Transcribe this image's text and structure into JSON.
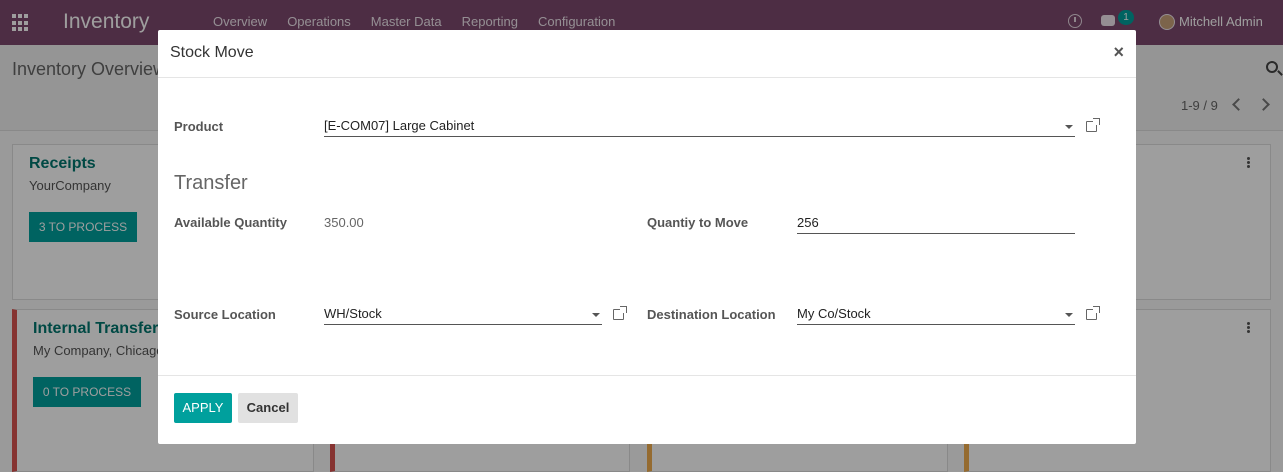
{
  "navbar": {
    "app_name": "Inventory",
    "menu": [
      "Overview",
      "Operations",
      "Master Data",
      "Reporting",
      "Configuration"
    ],
    "chat_count": "1",
    "user_name": "Mitchell Admin"
  },
  "control_panel": {
    "breadcrumb": "Inventory Overview",
    "pager": "1-9 / 9"
  },
  "cards": [
    {
      "title": "Receipts",
      "subtitle": "YourCompany",
      "button": "3 TO PROCESS"
    },
    {
      "title": "Internal Transfers",
      "subtitle": "My Company, Chicago",
      "button": "0 TO PROCESS"
    }
  ],
  "dialog": {
    "title": "Stock Move",
    "close": "×",
    "product_label": "Product",
    "product_value": "[E-COM07] Large Cabinet",
    "section_title": "Transfer",
    "available_label": "Available Quantity",
    "available_value": "350.00",
    "qty_label": "Quantiy to Move",
    "qty_value": "256",
    "source_label": "Source Location",
    "source_value": "WH/Stock",
    "dest_label": "Destination Location",
    "dest_value": "My Co/Stock",
    "apply": "APPLY",
    "cancel": "Cancel"
  },
  "colors": {
    "navbar": "#7c4a6e",
    "primary": "#00a09d",
    "card_title": "#00766f",
    "status_red": "#d9534f",
    "status_orange": "#f0ad4e"
  },
  "icons": [
    "apps-icon",
    "clock-icon",
    "chat-icon",
    "search-icon",
    "chevron-left-icon",
    "chevron-right-icon",
    "external-link-icon",
    "caret-down-icon",
    "kebab-menu-icon"
  ]
}
